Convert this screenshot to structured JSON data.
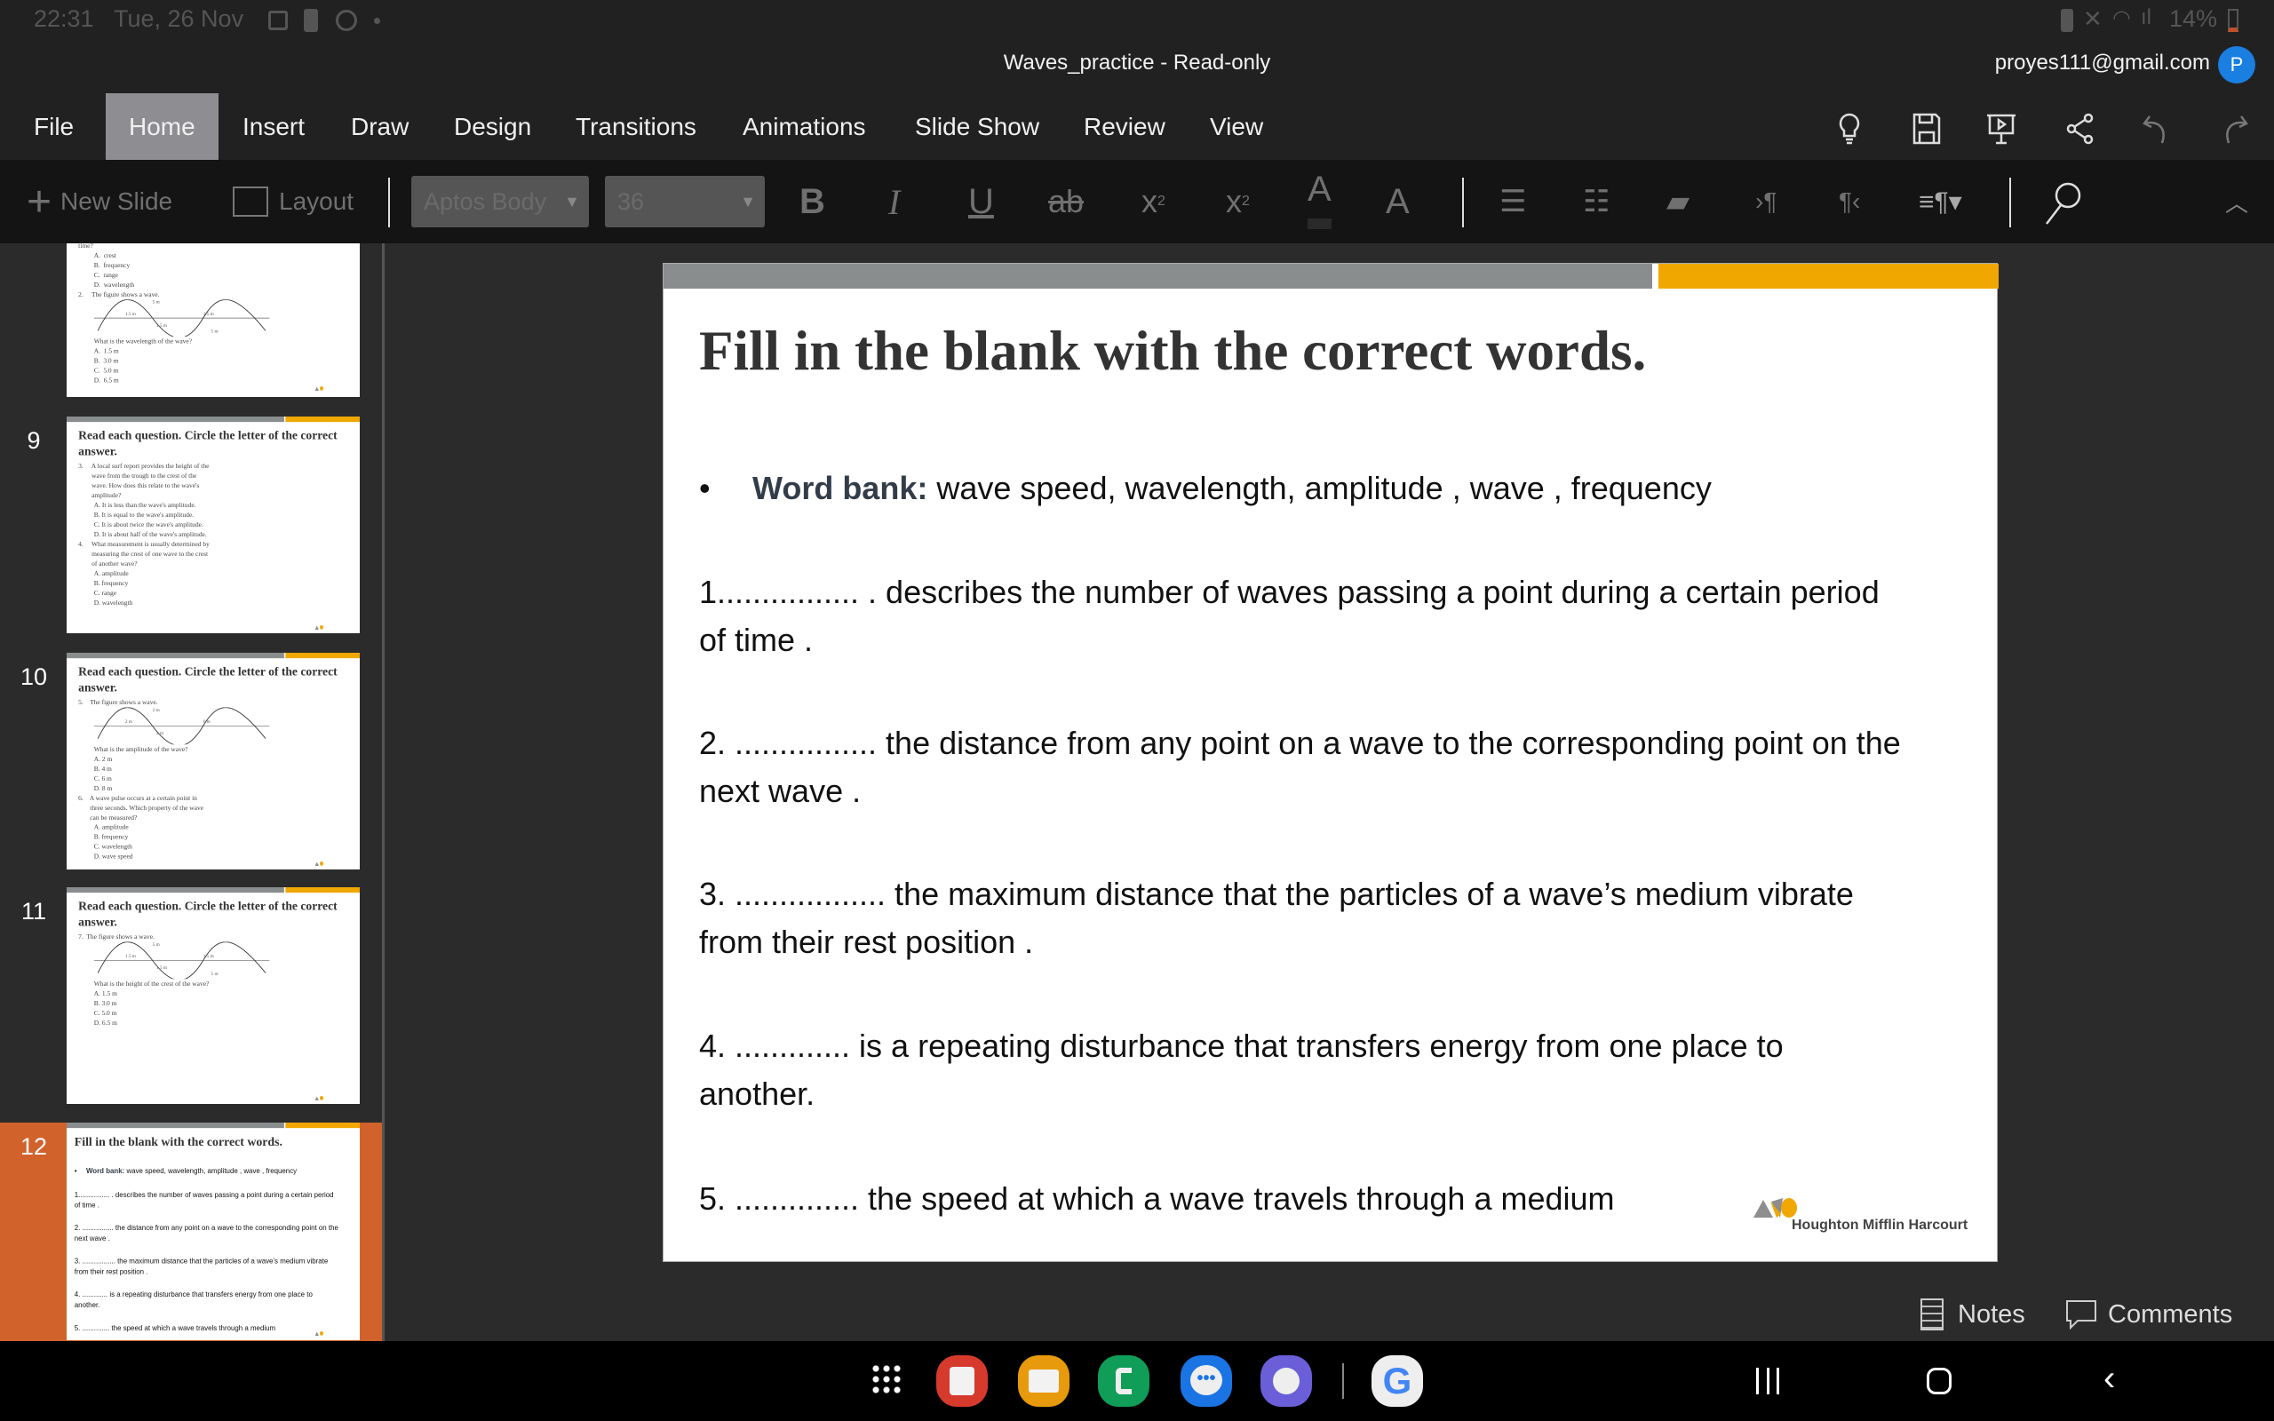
{
  "status_bar": {
    "time": "22:31",
    "date": "Tue, 26 Nov",
    "battery": "14%"
  },
  "window": {
    "title": "Waves_practice - Read-only",
    "account_email": "proyes111@gmail.com",
    "avatar_initial": "P",
    "avatar_color": "#1a7fe0"
  },
  "menu": {
    "tabs": [
      {
        "label": "File"
      },
      {
        "label": "Home",
        "active": true
      },
      {
        "label": "Insert"
      },
      {
        "label": "Draw"
      },
      {
        "label": "Design"
      },
      {
        "label": "Transitions"
      },
      {
        "label": "Animations"
      },
      {
        "label": "Slide Show"
      },
      {
        "label": "Review"
      },
      {
        "label": "View"
      }
    ],
    "right_icons": [
      "lightbulb-icon",
      "save-icon",
      "present-icon",
      "share-icon",
      "undo-icon",
      "redo-icon"
    ]
  },
  "toolbar": {
    "new_slide": "New Slide",
    "layout": "Layout",
    "font_name": "Aptos Body",
    "font_size": "36",
    "bold": "B",
    "italic": "I",
    "underline": "U",
    "strikethrough": "ab",
    "subscript": "x",
    "superscript": "x",
    "font_color": "A",
    "highlight": "A"
  },
  "thumbnails": [
    {
      "number": "",
      "partial": true,
      "title": "",
      "items": [
        {
          "t": "q",
          "text": "time?"
        },
        {
          "t": "opt",
          "text": "A.  crest"
        },
        {
          "t": "opt",
          "text": "B.  frequency"
        },
        {
          "t": "opt",
          "text": "C.  range"
        },
        {
          "t": "opt",
          "text": "D.  wavelength"
        },
        {
          "t": "q",
          "text": "2.     The figure shows a wave."
        },
        {
          "t": "fig",
          "labels": [
            "5 m",
            "1.5 m",
            "1.5 m",
            "1.5 m",
            "5 m"
          ]
        },
        {
          "t": "opt",
          "text": "What is the wavelength of the wave?"
        },
        {
          "t": "opt",
          "text": "A.  1.5 m"
        },
        {
          "t": "opt",
          "text": "B.  3.0 m"
        },
        {
          "t": "opt",
          "text": "C.  5.0 m"
        },
        {
          "t": "opt",
          "text": "D.  6.5 m"
        }
      ]
    },
    {
      "number": "9",
      "title": "Read each question. Circle the letter of the correct answer.",
      "items": [
        {
          "t": "q",
          "text": "3.     A local surf report provides the height of the\n        wave from the trough to the crest of the\n        wave. How does this relate to the wave's\n        amplitude?"
        },
        {
          "t": "opt",
          "text": "A. It is less than the wave's amplitude."
        },
        {
          "t": "opt",
          "text": "B. It is equal to the wave's amplitude."
        },
        {
          "t": "opt",
          "text": "C. It is about twice the wave's amplitude."
        },
        {
          "t": "opt",
          "text": "D. It is about half of the wave's amplitude."
        },
        {
          "t": "q",
          "text": "4.     What measurement is usually determined by\n        measuring the crest of one wave to the crest\n        of another wave?"
        },
        {
          "t": "opt",
          "text": "A. amplitude"
        },
        {
          "t": "opt",
          "text": "B. frequency"
        },
        {
          "t": "opt",
          "text": "C. range"
        },
        {
          "t": "opt",
          "text": "D. wavelength"
        }
      ]
    },
    {
      "number": "10",
      "title": "Read each question. Circle the letter of the correct answer.",
      "items": [
        {
          "t": "q",
          "text": "5.    The figure shows a wave."
        },
        {
          "t": "fig",
          "labels": [
            "2 m",
            "2 m",
            "2 m",
            "6 m"
          ]
        },
        {
          "t": "opt",
          "text": "What is the amplitude of the wave?"
        },
        {
          "t": "opt",
          "text": "A. 2 m"
        },
        {
          "t": "opt",
          "text": "B. 4 m"
        },
        {
          "t": "opt",
          "text": "C. 6 m"
        },
        {
          "t": "opt",
          "text": "D. 8 m"
        },
        {
          "t": "q",
          "text": "6.    A wave pulse occurs at a certain point in\n       three seconds. Which property of the wave\n       can be measured?"
        },
        {
          "t": "opt",
          "text": "A. amplitude"
        },
        {
          "t": "opt",
          "text": "B. frequency"
        },
        {
          "t": "opt",
          "text": "C. wavelength"
        },
        {
          "t": "opt",
          "text": "D. wave speed"
        }
      ]
    },
    {
      "number": "11",
      "title": "Read each question. Circle the letter of the correct answer.",
      "items": [
        {
          "t": "q",
          "text": "7.  The figure shows a wave."
        },
        {
          "t": "fig",
          "labels": [
            "5 m",
            "1.5 m",
            "1.5 m",
            "1.5 m",
            "5 m"
          ]
        },
        {
          "t": "opt",
          "text": "What is the height of the crest of the wave?"
        },
        {
          "t": "opt",
          "text": "A. 1.5 m"
        },
        {
          "t": "opt",
          "text": "B. 3.0 m"
        },
        {
          "t": "opt",
          "text": "C. 5.0 m"
        },
        {
          "t": "opt",
          "text": "D. 6.5 m"
        }
      ]
    },
    {
      "number": "12",
      "selected": true,
      "mirror_main": true,
      "title": "Fill in the blank with the correct words.",
      "items": []
    }
  ],
  "slide": {
    "title": "Fill in the blank with the correct words.",
    "word_bank_label": "Word bank:",
    "word_bank_words": " wave speed, wavelength, amplitude , wave , frequency",
    "items": [
      {
        "lines": [
          "1................ . describes the number of waves passing a point during a certain period",
          "of time ."
        ]
      },
      {
        "lines": [
          "2. ................ the distance from any point on a wave to the corresponding point on the",
          "next wave ."
        ]
      },
      {
        "lines": [
          "3. ................. the maximum distance that the particles of a wave’s medium vibrate",
          "from their rest position ."
        ]
      },
      {
        "lines": [
          "4. ............. is a repeating disturbance that transfers energy from one place to",
          "another."
        ]
      },
      {
        "lines": [
          "5. .............. the speed at which a wave travels through a medium"
        ]
      }
    ],
    "logo_text": "Houghton Mifflin Harcourt",
    "accent_orange": "#f0a800",
    "accent_gray": "#8a8d8d"
  },
  "bottom": {
    "notes": "Notes",
    "comments": "Comments"
  },
  "dock": [
    "apps-grid-icon",
    "notes-app-icon",
    "files-app-icon",
    "phone-app-icon",
    "messages-app-icon",
    "browser-app-icon",
    "google-app-icon"
  ],
  "selected_thumb_color": "#d1622b"
}
